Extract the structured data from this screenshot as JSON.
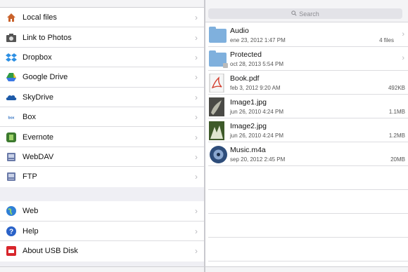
{
  "sources": [
    {
      "label": "Local files",
      "icon": "home-icon",
      "color": "#c9622b"
    },
    {
      "label": "Link to Photos",
      "icon": "photos-link-icon",
      "color": "#555555"
    },
    {
      "label": "Dropbox",
      "icon": "dropbox-icon",
      "color": "#2d8fe3"
    },
    {
      "label": "Google Drive",
      "icon": "google-drive-icon",
      "color": "#2f9a45"
    },
    {
      "label": "SkyDrive",
      "icon": "skydrive-icon",
      "color": "#1d5aa8"
    },
    {
      "label": "Box",
      "icon": "box-icon",
      "color": "#2a6cc0"
    },
    {
      "label": "Evernote",
      "icon": "evernote-icon",
      "color": "#3c7a2f"
    },
    {
      "label": "WebDAV",
      "icon": "webdav-drive-icon",
      "color": "#6a7aa8"
    },
    {
      "label": "FTP",
      "icon": "ftp-drive-icon",
      "color": "#6a7aa8"
    }
  ],
  "more": [
    {
      "label": "Web",
      "icon": "globe-icon",
      "color": "#2f7fd6"
    },
    {
      "label": "Help",
      "icon": "help-icon",
      "color": "#2a62c8"
    },
    {
      "label": "About USB Disk",
      "icon": "usb-disk-icon",
      "color": "#d8262c"
    }
  ],
  "search": {
    "placeholder": "Search"
  },
  "files": [
    {
      "name": "Audio",
      "date": "ene 23, 2012 1:47 PM",
      "meta": "4 files",
      "icon": "folder-icon",
      "chevron": true
    },
    {
      "name": "Protected",
      "date": "oct 28, 2013 5:54 PM",
      "meta": "",
      "icon": "protected-folder-icon",
      "chevron": true
    },
    {
      "name": "Book.pdf",
      "date": "feb 3, 2012 9:20 AM",
      "meta": "492KB",
      "icon": "pdf-icon",
      "chevron": false
    },
    {
      "name": "Image1.jpg",
      "date": "jun 26, 2010 4:24 PM",
      "meta": "1.1MB",
      "icon": "image-thumb-icon",
      "chevron": false
    },
    {
      "name": "Image2.jpg",
      "date": "jun 26, 2010 4:24 PM",
      "meta": "1.2MB",
      "icon": "image-thumb-icon",
      "chevron": false
    },
    {
      "name": "Music.m4a",
      "date": "sep 20, 2012 2:45 PM",
      "meta": "20MB",
      "icon": "music-icon",
      "chevron": false
    }
  ],
  "colors": {
    "folder": "#7fb0dd",
    "separator": "#dcdce0",
    "chevron": "#b8b8bd"
  }
}
